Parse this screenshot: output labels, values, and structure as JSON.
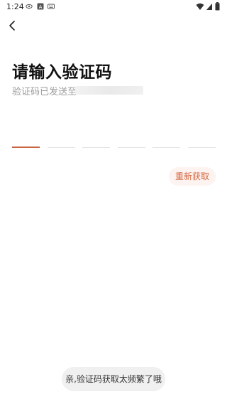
{
  "status_bar": {
    "time": "1:24",
    "icons": [
      "eye-icon",
      "a-badge-icon",
      "keyboard-icon",
      "wifi-icon",
      "signal-icon",
      "battery-icon"
    ]
  },
  "header": {
    "back_icon": "chevron-left-icon"
  },
  "main": {
    "title": "请输入验证码",
    "subtitle_prefix": "验证码已发送至",
    "code_boxes": [
      "",
      "",
      "",
      "",
      "",
      ""
    ],
    "resend_label": "重新获取"
  },
  "toast": {
    "message": "亲,验证码获取太频繁了哦"
  },
  "colors": {
    "accent": "#d7653d",
    "active_underline": "#c8643f",
    "subtitle": "#9c9c9c",
    "divider": "#e3e3e3"
  }
}
